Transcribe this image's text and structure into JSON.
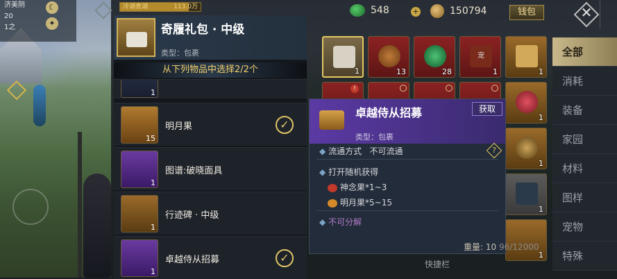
{
  "hud": {
    "lines": [
      "济美阴",
      "20",
      "1之"
    ],
    "target_label": "冷湖青湖",
    "target_amount": "113.0万",
    "target_fill": 0.85
  },
  "currency": {
    "jade_value": "548",
    "coin_value": "150794",
    "wallet_label": "钱包",
    "plus": "+"
  },
  "close_glyph": "✕",
  "gift": {
    "title": "奇履礼包 · 中级",
    "type": "类型：包裹",
    "select_banner": "从下列物品中选择2/2个",
    "options": [
      {
        "name": "明月果",
        "qty": "15",
        "checked": true,
        "check_glyph": "✓"
      },
      {
        "name": "图谱:破晓面具",
        "qty": "1",
        "checked": false
      },
      {
        "name": "行迹碑 · 中级",
        "qty": "1",
        "checked": false
      },
      {
        "name": "卓越侍从招募",
        "qty": "1",
        "checked": true,
        "check_glyph": "✓"
      }
    ],
    "partial_qty": "1"
  },
  "tooltip": {
    "title": "卓越侍从招募",
    "get_label": "获取",
    "type": "类型：包裹",
    "circulation": "流通方式",
    "circulation_value": "不可流通",
    "random_header": "打开随机获得",
    "rewards": [
      "神念果*1~3",
      "明月果*5~15"
    ],
    "unsalvageable": "不可分解",
    "help": "?"
  },
  "grid": {
    "qtys": [
      "1",
      "13",
      "28",
      "1",
      "1",
      "1",
      "1",
      "1",
      "1"
    ],
    "badge": "!",
    "rune_char": "宠"
  },
  "categories": [
    "全部",
    "消耗",
    "装备",
    "家园",
    "材料",
    "图样",
    "宠物",
    "特殊"
  ],
  "shortcut_label": "快捷栏",
  "weight": {
    "label": "重量:",
    "value": "10",
    "capacity": "96/12000"
  }
}
